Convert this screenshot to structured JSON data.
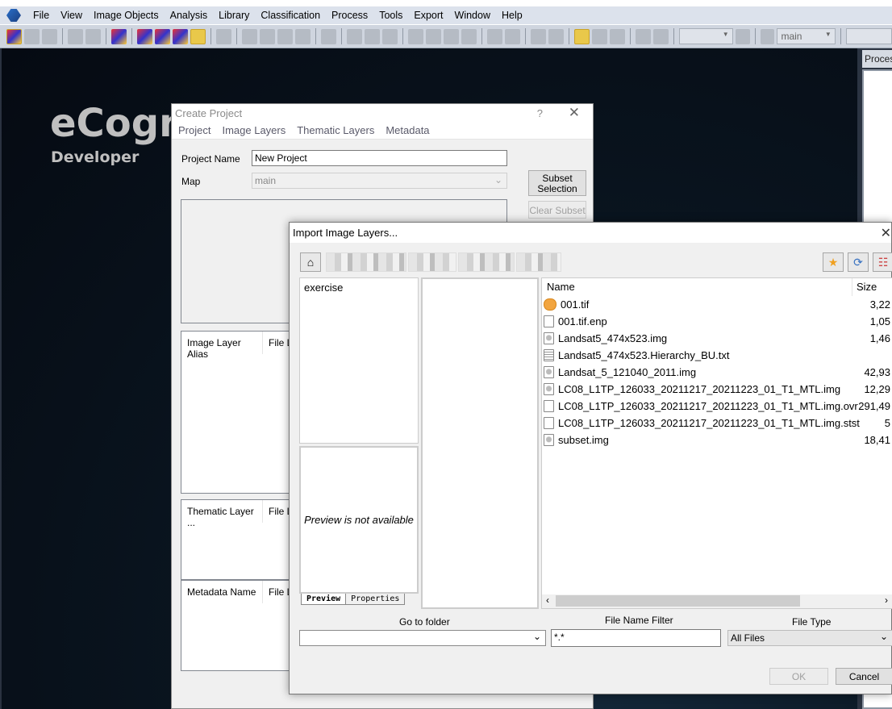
{
  "menubar": {
    "items": [
      "File",
      "View",
      "Image Objects",
      "Analysis",
      "Library",
      "Classification",
      "Process",
      "Tools",
      "Export",
      "Window",
      "Help"
    ]
  },
  "toolbar": {
    "icons": [
      "create-project-icon",
      "open-project-icon",
      "save-project-icon",
      "|",
      "new-workspace-icon",
      "open-workspace-icon",
      "|",
      "view-settings-icon",
      "|",
      "image-layer-info-icon",
      "process-tree-icon",
      "feature-view-icon",
      "object-info-icon",
      "|",
      "image-view-icon",
      "|",
      "split-horizontal-icon",
      "split-vertical-icon",
      "swipe-icon",
      "compare-icon",
      "|",
      "layer-stack-icon",
      "|",
      "pan-view-1-icon",
      "pan-view-2-icon",
      "pan-view-3-icon",
      "|",
      "layout-1-icon",
      "layout-2-icon",
      "layout-3-icon",
      "layout-4-icon",
      "|",
      "select-object-icon",
      "merge-object-icon",
      "|",
      "polygon-icon",
      "shape-icon",
      "|",
      "pointer-icon",
      "hand-icon",
      "zoom-user-icon",
      "|",
      "zoom-out-icon",
      "zoom-in-icon"
    ],
    "active": [
      "create-project-icon",
      "object-info-icon",
      "pointer-icon"
    ],
    "zoom_select": "",
    "map_select": "main"
  },
  "brand": {
    "name": "eCogn",
    "edition": "Developer"
  },
  "process_panel": {
    "title": "Proces"
  },
  "create_project": {
    "title": "Create Project",
    "help": "?",
    "close": "✕",
    "tabs": [
      "Project",
      "Image Layers",
      "Thematic Layers",
      "Metadata"
    ],
    "project_name_label": "Project Name",
    "project_name_value": "New Project",
    "map_label": "Map",
    "map_value": "main",
    "subset_selection": "Subset\nSelection",
    "clear_subset": "Clear Subset",
    "image_layer_cols": [
      "Image Layer Alias",
      "File L"
    ],
    "thematic_layer_cols": [
      "Thematic Layer ...",
      "File L"
    ],
    "metadata_cols": [
      "Metadata Name",
      "File L"
    ]
  },
  "import_dialog": {
    "title": "Import Image Layers...",
    "close": "✕",
    "folder_tree": [
      "exercise"
    ],
    "preview_text": "Preview is not available",
    "preview_tabs": [
      "Preview",
      "Properties"
    ],
    "columns": [
      "Name",
      "Size"
    ],
    "files": [
      {
        "name": "001.tif",
        "size": "3,22",
        "type": "tif"
      },
      {
        "name": "001.tif.enp",
        "size": "1,05",
        "type": "blank"
      },
      {
        "name": "Landsat5_474x523.img",
        "size": "1,46",
        "type": "img"
      },
      {
        "name": "Landsat5_474x523.Hierarchy_BU.txt",
        "size": "",
        "type": "txt"
      },
      {
        "name": "Landsat_5_121040_2011.img",
        "size": "42,93",
        "type": "img"
      },
      {
        "name": "LC08_L1TP_126033_20211217_20211223_01_T1_MTL.img",
        "size": "12,29",
        "type": "img"
      },
      {
        "name": "LC08_L1TP_126033_20211217_20211223_01_T1_MTL.img.ovr",
        "size": "291,49",
        "type": "blank"
      },
      {
        "name": "LC08_L1TP_126033_20211217_20211223_01_T1_MTL.img.stst",
        "size": "5",
        "type": "blank"
      },
      {
        "name": "subset.img",
        "size": "18,41",
        "type": "img"
      }
    ],
    "go_to_folder_label": "Go to folder",
    "go_to_folder_value": "",
    "filter_label": "File Name Filter",
    "filter_value": "*.*",
    "file_type_label": "File Type",
    "file_type_value": "All Files",
    "ok": "OK",
    "cancel": "Cancel"
  }
}
